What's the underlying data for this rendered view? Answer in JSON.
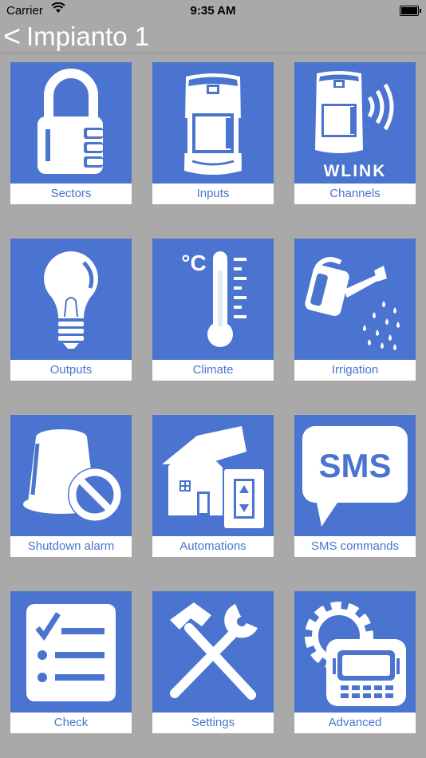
{
  "status_bar": {
    "carrier": "Carrier",
    "time": "9:35 AM"
  },
  "nav": {
    "back_glyph": "<",
    "title": "Impianto 1"
  },
  "tiles": [
    {
      "label": "Sectors",
      "icon": "padlock-icon"
    },
    {
      "label": "Inputs",
      "icon": "sensor-icon"
    },
    {
      "label": "Channels",
      "icon": "wireless-sensor-icon",
      "art_text": "WLINK"
    },
    {
      "label": "Outputs",
      "icon": "lightbulb-icon"
    },
    {
      "label": "Climate",
      "icon": "thermometer-icon",
      "art_text": "°C"
    },
    {
      "label": "Irrigation",
      "icon": "watering-can-icon"
    },
    {
      "label": "Shutdown alarm",
      "icon": "siren-off-icon"
    },
    {
      "label": "Automations",
      "icon": "house-icon"
    },
    {
      "label": "SMS commands",
      "icon": "sms-bubble-icon",
      "art_text": "SMS"
    },
    {
      "label": "Check",
      "icon": "checklist-icon"
    },
    {
      "label": "Settings",
      "icon": "tools-icon"
    },
    {
      "label": "Advanced",
      "icon": "keypad-gear-icon"
    }
  ]
}
